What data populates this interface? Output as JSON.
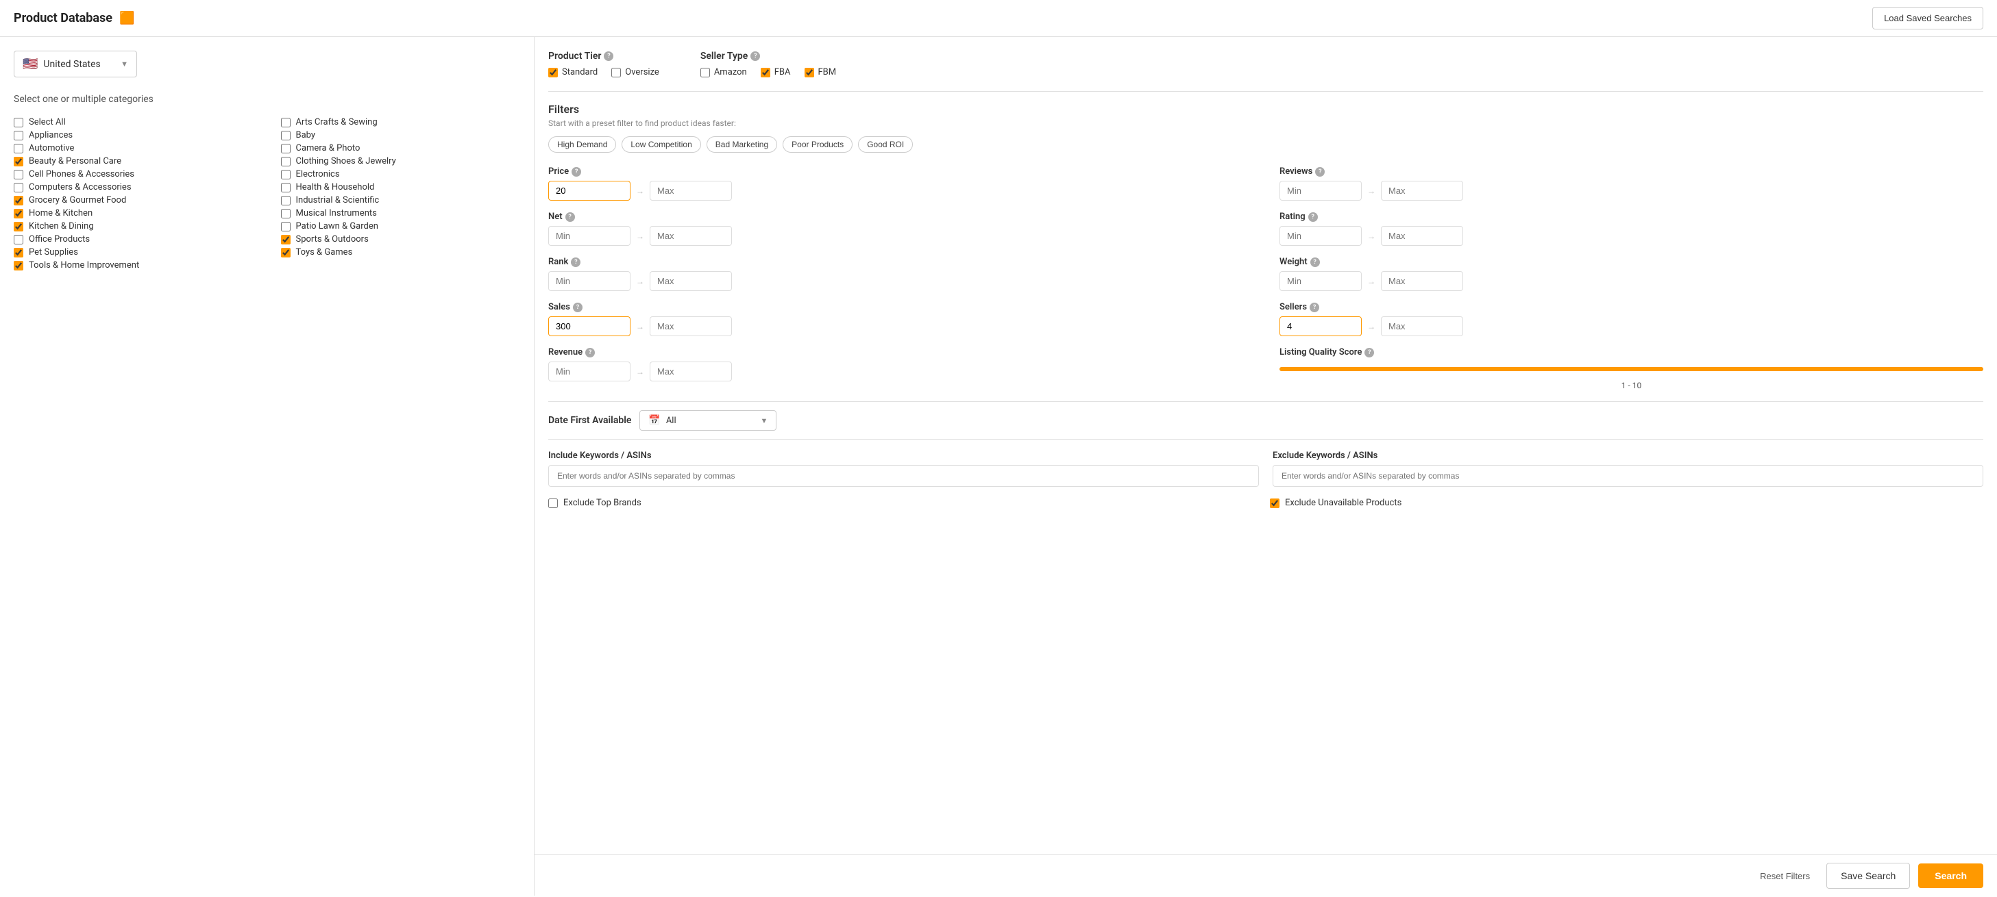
{
  "header": {
    "title": "Product Database",
    "icon": "🟧",
    "load_saved_label": "Load Saved Searches"
  },
  "country": {
    "name": "United States",
    "flag": "🇺🇸"
  },
  "categories": {
    "section_title": "Select one or multiple categories",
    "left_column": [
      {
        "id": "select_all",
        "label": "Select All",
        "checked": false
      },
      {
        "id": "appliances",
        "label": "Appliances",
        "checked": false
      },
      {
        "id": "automotive",
        "label": "Automotive",
        "checked": false
      },
      {
        "id": "beauty",
        "label": "Beauty & Personal Care",
        "checked": true
      },
      {
        "id": "cell_phones",
        "label": "Cell Phones & Accessories",
        "checked": false
      },
      {
        "id": "computers",
        "label": "Computers & Accessories",
        "checked": false
      },
      {
        "id": "grocery",
        "label": "Grocery & Gourmet Food",
        "checked": true
      },
      {
        "id": "home_kitchen",
        "label": "Home & Kitchen",
        "checked": true
      },
      {
        "id": "kitchen_dining",
        "label": "Kitchen & Dining",
        "checked": true
      },
      {
        "id": "office",
        "label": "Office Products",
        "checked": false
      },
      {
        "id": "pet",
        "label": "Pet Supplies",
        "checked": true
      },
      {
        "id": "tools",
        "label": "Tools & Home Improvement",
        "checked": true
      }
    ],
    "right_column": [
      {
        "id": "arts_crafts",
        "label": "Arts Crafts & Sewing",
        "checked": false
      },
      {
        "id": "baby",
        "label": "Baby",
        "checked": false
      },
      {
        "id": "camera",
        "label": "Camera & Photo",
        "checked": false
      },
      {
        "id": "clothing",
        "label": "Clothing Shoes & Jewelry",
        "checked": false
      },
      {
        "id": "electronics",
        "label": "Electronics",
        "checked": false
      },
      {
        "id": "health",
        "label": "Health & Household",
        "checked": false
      },
      {
        "id": "industrial",
        "label": "Industrial & Scientific",
        "checked": false
      },
      {
        "id": "musical",
        "label": "Musical Instruments",
        "checked": false
      },
      {
        "id": "patio",
        "label": "Patio Lawn & Garden",
        "checked": false
      },
      {
        "id": "sports",
        "label": "Sports & Outdoors",
        "checked": true
      },
      {
        "id": "toys",
        "label": "Toys & Games",
        "checked": true
      }
    ]
  },
  "product_tier": {
    "title": "Product Tier",
    "options": [
      {
        "id": "standard",
        "label": "Standard",
        "checked": true
      },
      {
        "id": "oversize",
        "label": "Oversize",
        "checked": false
      }
    ]
  },
  "seller_type": {
    "title": "Seller Type",
    "options": [
      {
        "id": "amazon",
        "label": "Amazon",
        "checked": false
      },
      {
        "id": "fba",
        "label": "FBA",
        "checked": true
      },
      {
        "id": "fbm",
        "label": "FBM",
        "checked": true
      }
    ]
  },
  "filters": {
    "title": "Filters",
    "subtitle": "Start with a preset filter to find product ideas faster:",
    "presets": [
      {
        "id": "high_demand",
        "label": "High Demand"
      },
      {
        "id": "low_competition",
        "label": "Low Competition"
      },
      {
        "id": "bad_marketing",
        "label": "Bad Marketing"
      },
      {
        "id": "poor_products",
        "label": "Poor Products"
      },
      {
        "id": "good_roi",
        "label": "Good ROI"
      }
    ],
    "price": {
      "label": "Price",
      "min": "20",
      "max": "",
      "min_placeholder": "Min",
      "max_placeholder": "Max"
    },
    "reviews": {
      "label": "Reviews",
      "min": "",
      "max": "",
      "min_placeholder": "Min",
      "max_placeholder": "Max"
    },
    "net": {
      "label": "Net",
      "min": "",
      "max": "",
      "min_placeholder": "Min",
      "max_placeholder": "Max"
    },
    "rating": {
      "label": "Rating",
      "min": "",
      "max": "",
      "min_placeholder": "Min",
      "max_placeholder": "Max"
    },
    "rank": {
      "label": "Rank",
      "min": "",
      "max": "",
      "min_placeholder": "Min",
      "max_placeholder": "Max"
    },
    "weight": {
      "label": "Weight",
      "min": "",
      "max": "",
      "min_placeholder": "Min",
      "max_placeholder": "Max"
    },
    "sales": {
      "label": "Sales",
      "min": "300",
      "max": "",
      "min_placeholder": "Min",
      "max_placeholder": "Max"
    },
    "sellers": {
      "label": "Sellers",
      "min": "4",
      "max": "",
      "min_placeholder": "Min",
      "max_placeholder": "Max"
    },
    "revenue": {
      "label": "Revenue",
      "min": "",
      "max": "",
      "min_placeholder": "Min",
      "max_placeholder": "Max"
    },
    "lqs": {
      "label": "Listing Quality Score",
      "range": "1  -  10"
    }
  },
  "date": {
    "label": "Date First Available",
    "value": "All"
  },
  "keywords": {
    "include_label": "Include Keywords / ASINs",
    "include_placeholder": "Enter words and/or ASINs separated by commas",
    "exclude_label": "Exclude Keywords / ASINs",
    "exclude_placeholder": "Enter words and/or ASINs separated by commas"
  },
  "bottom_options": [
    {
      "id": "exclude_top_brands",
      "label": "Exclude Top Brands",
      "checked": false
    },
    {
      "id": "exclude_unavailable",
      "label": "Exclude Unavailable Products",
      "checked": true
    }
  ],
  "actions": {
    "reset_label": "Reset Filters",
    "save_label": "Save Search",
    "search_label": "Search"
  }
}
